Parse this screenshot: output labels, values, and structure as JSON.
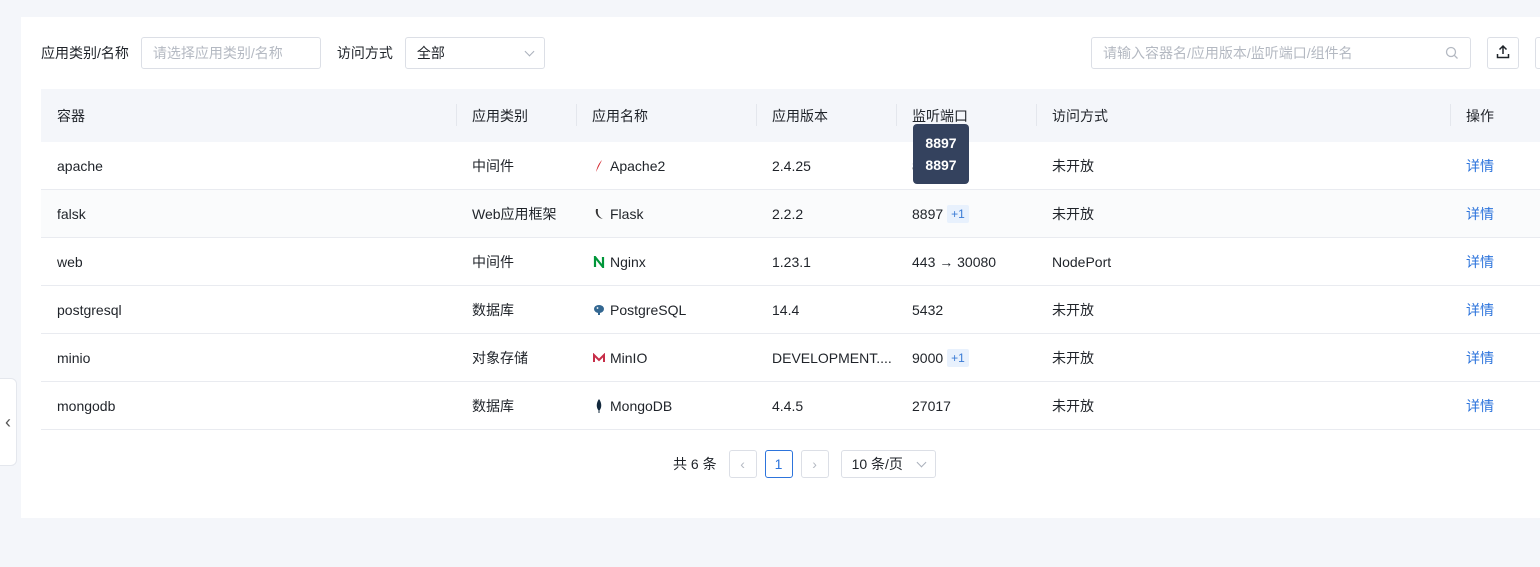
{
  "filters": {
    "category_label": "应用类别/名称",
    "category_placeholder": "请选择应用类别/名称",
    "access_label": "访问方式",
    "access_value": "全部"
  },
  "search": {
    "placeholder": "请输入容器名/应用版本/监听端口/组件名"
  },
  "table": {
    "headers": [
      "容器",
      "应用类别",
      "应用名称",
      "应用版本",
      "监听端口",
      "访问方式",
      "操作"
    ],
    "rows": [
      {
        "container": "apache",
        "category": "中间件",
        "app_icon": "apache-feather-icon",
        "app_name": "Apache2",
        "version": "2.4.25",
        "port": "8897",
        "port_extra": "",
        "access": "未开放",
        "action": "详情"
      },
      {
        "container": "falsk",
        "category": "Web应用框架",
        "app_icon": "flask-icon",
        "app_name": "Flask",
        "version": "2.2.2",
        "port": "8897",
        "port_extra": "+1",
        "access": "未开放",
        "action": "详情"
      },
      {
        "container": "web",
        "category": "中间件",
        "app_icon": "nginx-icon",
        "app_name": "Nginx",
        "version": "1.23.1",
        "port": "443 → 30080",
        "port_extra": "",
        "access": "NodePort",
        "action": "详情"
      },
      {
        "container": "postgresql",
        "category": "数据库",
        "app_icon": "postgresql-elephant-icon",
        "app_name": "PostgreSQL",
        "version": "14.4",
        "port": "5432",
        "port_extra": "",
        "access": "未开放",
        "action": "详情"
      },
      {
        "container": "minio",
        "category": "对象存储",
        "app_icon": "minio-icon",
        "app_name": "MinIO",
        "version": "DEVELOPMENT....",
        "port": "9000",
        "port_extra": "+1",
        "access": "未开放",
        "action": "详情"
      },
      {
        "container": "mongodb",
        "category": "数据库",
        "app_icon": "mongodb-leaf-icon",
        "app_name": "MongoDB",
        "version": "4.4.5",
        "port": "27017",
        "port_extra": "",
        "access": "未开放",
        "action": "详情"
      }
    ]
  },
  "tooltip": {
    "lines": [
      "8897",
      "8897"
    ]
  },
  "pagination": {
    "total": "共 6 条",
    "current": "1",
    "page_size": "10 条/页"
  },
  "colors": {
    "link": "#2d74dc",
    "tooltip_bg": "#34425e",
    "header_bg": "#f4f6fa"
  }
}
